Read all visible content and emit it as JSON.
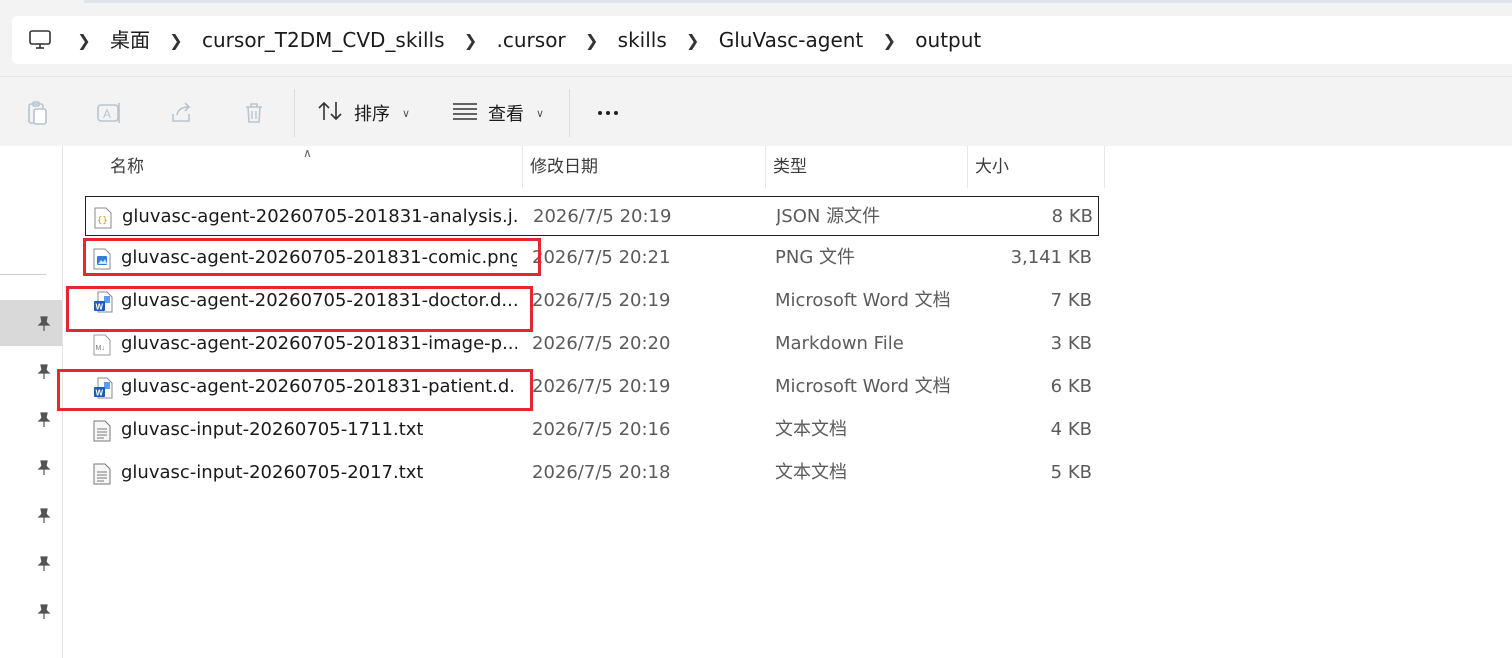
{
  "breadcrumb": {
    "root_icon": "computer-icon",
    "items": [
      "桌面",
      "cursor_T2DM_CVD_skills",
      ".cursor",
      "skills",
      "GluVasc-agent",
      "output"
    ]
  },
  "toolbar": {
    "icons": [
      "clipboard-icon",
      "rename-icon",
      "share-icon",
      "delete-icon"
    ],
    "sort_label": "排序",
    "view_label": "查看",
    "more_icon": "more-icon"
  },
  "columns": {
    "name": "名称",
    "date": "修改日期",
    "type": "类型",
    "size": "大小"
  },
  "files": [
    {
      "name": "gluvasc-agent-20260705-201831-analysis.j...",
      "date": "2026/7/5 20:19",
      "type": "JSON 源文件",
      "size": "8 KB",
      "icon": "json-file-icon"
    },
    {
      "name": "gluvasc-agent-20260705-201831-comic.png",
      "date": "2026/7/5 20:21",
      "type": "PNG 文件",
      "size": "3,141 KB",
      "icon": "png-file-icon"
    },
    {
      "name": "gluvasc-agent-20260705-201831-doctor.d...",
      "date": "2026/7/5 20:19",
      "type": "Microsoft Word 文档",
      "size": "7 KB",
      "icon": "word-file-icon"
    },
    {
      "name": "gluvasc-agent-20260705-201831-image-p...",
      "date": "2026/7/5 20:20",
      "type": "Markdown File",
      "size": "3 KB",
      "icon": "markdown-file-icon"
    },
    {
      "name": "gluvasc-agent-20260705-201831-patient.d...",
      "date": "2026/7/5 20:19",
      "type": "Microsoft Word 文档",
      "size": "6 KB",
      "icon": "word-file-icon"
    },
    {
      "name": "gluvasc-input-20260705-1711.txt",
      "date": "2026/7/5 20:16",
      "type": "文本文档",
      "size": "4 KB",
      "icon": "text-file-icon"
    },
    {
      "name": "gluvasc-input-20260705-2017.txt",
      "date": "2026/7/5 20:18",
      "type": "文本文档",
      "size": "5 KB",
      "icon": "text-file-icon"
    }
  ],
  "colors": {
    "annotation": "#e8262b",
    "word_blue": "#1f5bbf"
  }
}
